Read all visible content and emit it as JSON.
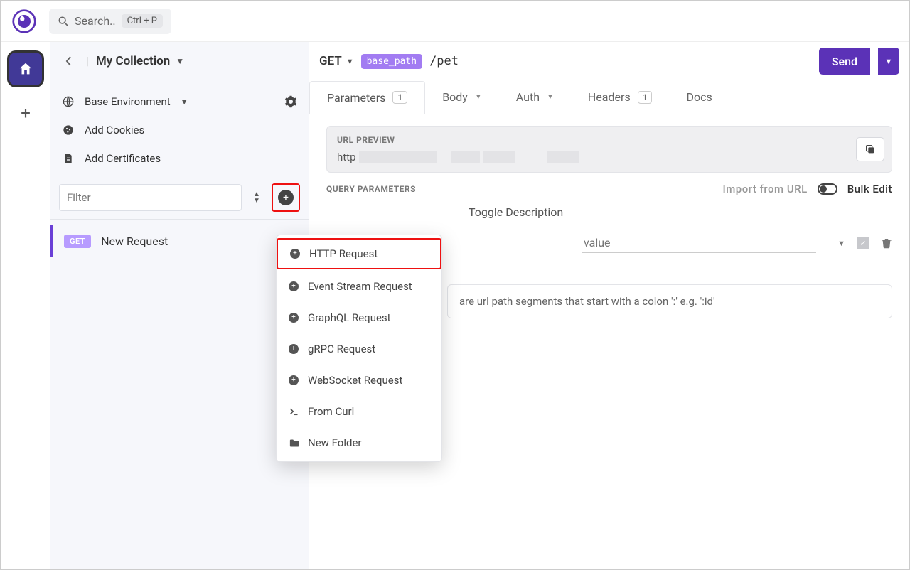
{
  "topbar": {
    "search_placeholder": "Search..",
    "search_shortcut": "Ctrl + P"
  },
  "sidebar": {
    "collection_title": "My Collection",
    "env_label": "Base Environment",
    "cookies_label": "Add Cookies",
    "certs_label": "Add Certificates",
    "filter_placeholder": "Filter",
    "requests": [
      {
        "method": "GET",
        "name": "New Request"
      }
    ]
  },
  "context_menu": {
    "items": [
      {
        "label": "HTTP Request",
        "icon": "plus",
        "highlight": true
      },
      {
        "label": "Event Stream Request",
        "icon": "plus"
      },
      {
        "label": "GraphQL Request",
        "icon": "plus"
      },
      {
        "label": "gRPC Request",
        "icon": "plus"
      },
      {
        "label": "WebSocket Request",
        "icon": "plus"
      },
      {
        "label": "From Curl",
        "icon": "terminal"
      },
      {
        "label": "New Folder",
        "icon": "folder"
      }
    ]
  },
  "request": {
    "method": "GET",
    "base_chip": "base_path",
    "path": "/pet",
    "send_label": "Send"
  },
  "tabs": {
    "parameters": {
      "label": "Parameters",
      "count": "1"
    },
    "body": {
      "label": "Body"
    },
    "auth": {
      "label": "Auth"
    },
    "headers": {
      "label": "Headers",
      "count": "1"
    },
    "docs": {
      "label": "Docs"
    }
  },
  "url_preview": {
    "label": "URL PREVIEW",
    "prefix": "http"
  },
  "query_params": {
    "label": "QUERY PARAMETERS",
    "import_label": "Import from URL",
    "bulk_label": "Bulk Edit",
    "toggle_desc": "Toggle Description",
    "value_placeholder": "value"
  },
  "path_hint": "are url path segments that start with a colon ':' e.g. ':id'"
}
